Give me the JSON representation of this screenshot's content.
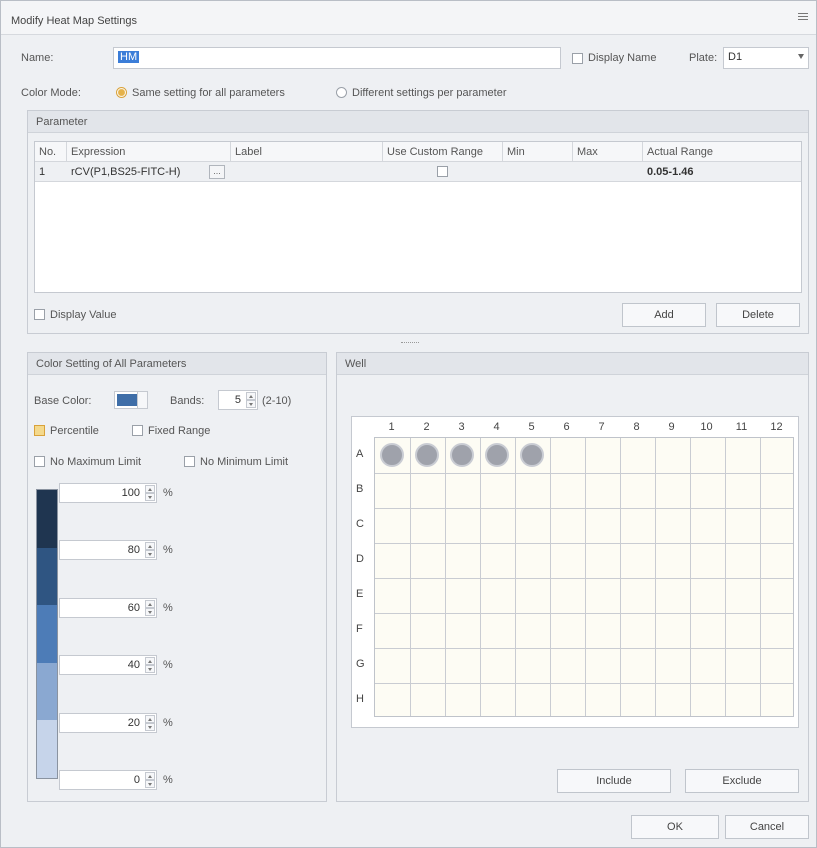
{
  "window": {
    "title": "Modify Heat Map Settings"
  },
  "top": {
    "name_label": "Name:",
    "name_value": "HM",
    "display_name_label": "Display Name",
    "plate_label": "Plate:",
    "plate_value": "D1",
    "color_mode_label": "Color Mode:",
    "color_mode_same": "Same setting for all parameters",
    "color_mode_different": "Different settings per parameter"
  },
  "parameter": {
    "title": "Parameter",
    "columns": [
      "No.",
      "Expression",
      "Label",
      "Use Custom Range",
      "Min",
      "Max",
      "Actual Range"
    ],
    "rows": [
      {
        "no": "1",
        "expression": "rCV(P1,BS25-FITC-H)",
        "label": "",
        "min": "",
        "max": "",
        "actual_range": "0.05-1.46"
      }
    ],
    "ellipsis": "...",
    "display_value_label": "Display Value",
    "add_label": "Add",
    "delete_label": "Delete"
  },
  "color_setting": {
    "title": "Color Setting of All Parameters",
    "base_color_label": "Base Color:",
    "base_color": "#3f6ea8",
    "bands_label": "Bands:",
    "bands_value": "5",
    "bands_range": "(2-10)",
    "percentile_label": "Percentile",
    "fixed_range_label": "Fixed Range",
    "no_max_label": "No Maximum Limit",
    "no_min_label": "No Minimum Limit",
    "thresholds": [
      "100",
      "80",
      "60",
      "40",
      "20",
      "0"
    ],
    "unit": "%",
    "band_colors": [
      "#1f3550",
      "#2f5582",
      "#4d7cb7",
      "#8aa8d1",
      "#c6d4ea"
    ]
  },
  "well": {
    "title": "Well",
    "columns": [
      "1",
      "2",
      "3",
      "4",
      "5",
      "6",
      "7",
      "8",
      "9",
      "10",
      "11",
      "12"
    ],
    "rows": [
      "A",
      "B",
      "C",
      "D",
      "E",
      "F",
      "G",
      "H"
    ],
    "include_label": "Include",
    "exclude_label": "Exclude"
  },
  "footer": {
    "ok_label": "OK",
    "cancel_label": "Cancel"
  }
}
